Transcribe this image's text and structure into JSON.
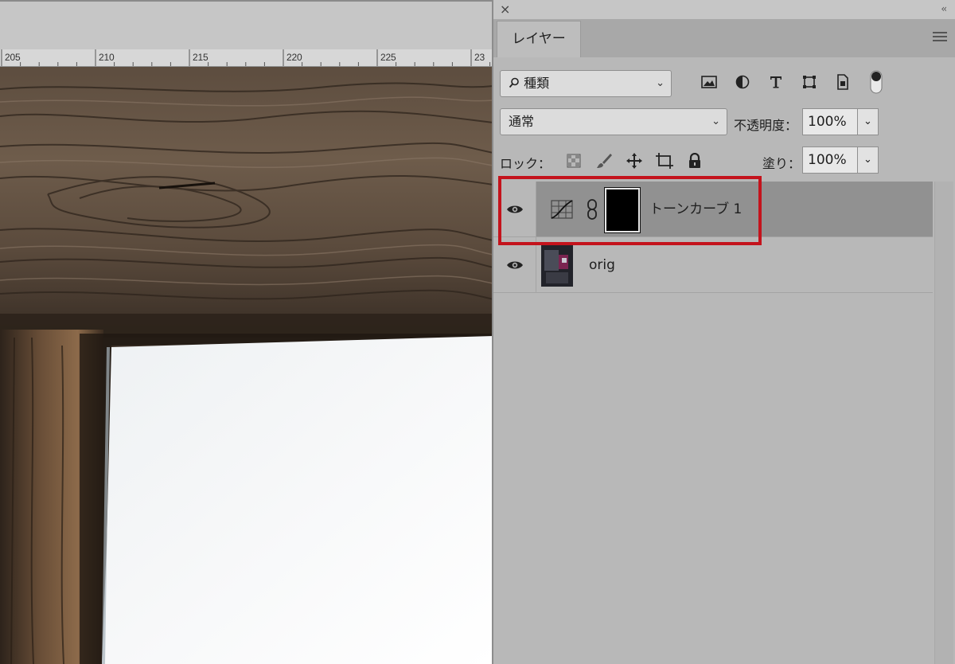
{
  "ruler": {
    "labels": [
      "205",
      "210",
      "215",
      "220",
      "225",
      "23"
    ]
  },
  "panel": {
    "close_glyph": "×",
    "collapse_glyph": "‹‹",
    "tab_label": "レイヤー",
    "filter": {
      "selected": "種類",
      "icons": [
        "image-filter-icon",
        "adjustment-filter-icon",
        "type-filter-icon",
        "shape-filter-icon",
        "smart-object-filter-icon",
        "filter-toggle-icon"
      ]
    },
    "blend_mode": "通常",
    "opacity_label": "不透明度：",
    "opacity_value": "100%",
    "lock_label": "ロック：",
    "fill_label": "塗り：",
    "fill_value": "100%",
    "layers": [
      {
        "name": "トーンカーブ 1",
        "type": "adjustment",
        "visible": true,
        "selected": true
      },
      {
        "name": "orig",
        "type": "pixel",
        "visible": true,
        "selected": false
      }
    ]
  },
  "colors": {
    "highlight": "#c4131c",
    "panel_bg": "#b8b8b8",
    "selected_row": "#919191"
  }
}
